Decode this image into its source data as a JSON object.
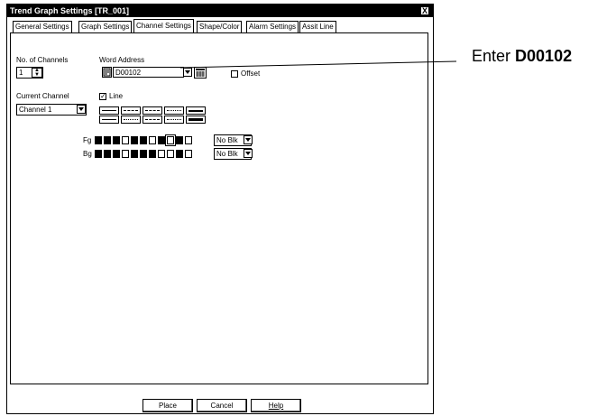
{
  "window": {
    "title": "Trend Graph Settings [TR_001]",
    "close_glyph": "X"
  },
  "tabs": [
    {
      "label": "General Settings"
    },
    {
      "label": "Graph Settings"
    },
    {
      "label": "Channel Settings",
      "active": true
    },
    {
      "label": "Shape/Color"
    },
    {
      "label": "Alarm Settings"
    },
    {
      "label": "Assit Line"
    }
  ],
  "channels": {
    "label": "No. of Channels",
    "value": "1"
  },
  "word_address": {
    "label": "Word Address",
    "value": "D00102",
    "offset_label": "Offset",
    "offset_checked": false
  },
  "current_channel": {
    "label": "Current Channel",
    "value": "Channel 1"
  },
  "line": {
    "label": "Line",
    "checked": true
  },
  "fg": {
    "label": "Fg",
    "select_value": "No Blk",
    "selected_index": 8
  },
  "bg": {
    "label": "Bg",
    "select_value": "No Blk"
  },
  "buttons": {
    "place": "Place",
    "cancel": "Cancel",
    "help": "Help"
  },
  "annotation": {
    "prefix": "Enter ",
    "value": "D00102"
  },
  "colors": {
    "swatch_dark": "#000000",
    "swatch_light": "#ffffff"
  },
  "icons": {
    "close": "close-icon",
    "address": "address-picker-icon",
    "keypad": "keypad-icon"
  }
}
